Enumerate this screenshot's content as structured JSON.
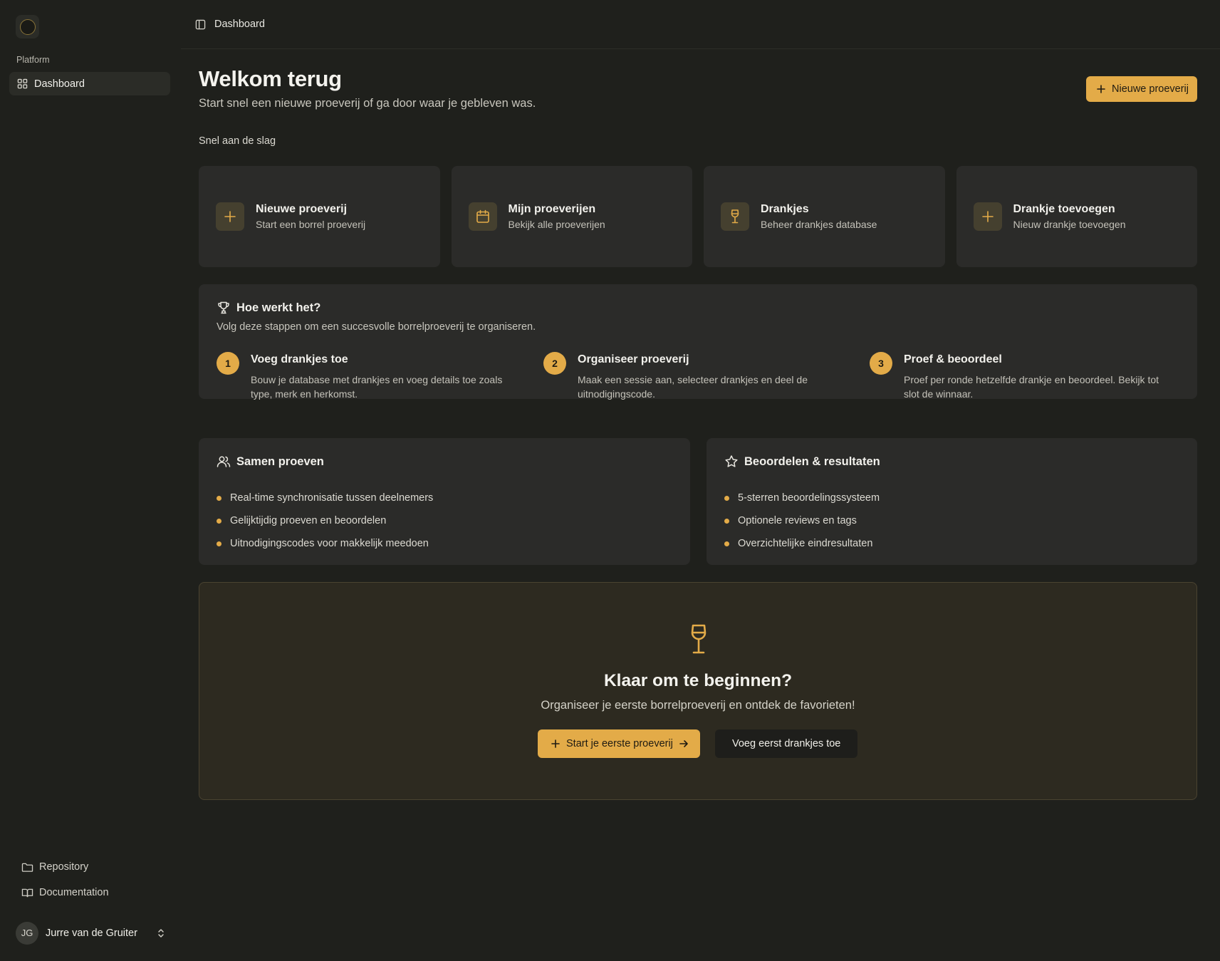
{
  "colors": {
    "accent": "#e3ab48",
    "background": "#1f201c",
    "card": "#2b2b29"
  },
  "topbar": {
    "title": "Dashboard",
    "toggle_icon": "sidebar-toggle-icon"
  },
  "sidebar": {
    "group_label": "Platform",
    "active_item": {
      "label": "Dashboard",
      "icon": "grid-icon"
    },
    "links": [
      {
        "label": "Repository",
        "icon": "folder-icon"
      },
      {
        "label": "Documentation",
        "icon": "book-icon"
      }
    ],
    "user": {
      "initials": "JG",
      "name": "Jurre van de Gruiter"
    }
  },
  "header": {
    "title": "Welkom terug",
    "subtitle": "Start snel een nieuwe proeverij of ga door waar je gebleven was.",
    "new_button": "Nieuwe proeverij"
  },
  "quick_start": {
    "label": "Snel aan de slag",
    "cards": [
      {
        "title": "Nieuwe proeverij",
        "desc": "Start een borrel proeverij",
        "icon": "plus-icon"
      },
      {
        "title": "Mijn proeverijen",
        "desc": "Bekijk alle proeverijen",
        "icon": "calendar-icon"
      },
      {
        "title": "Drankjes",
        "desc": "Beheer drankjes database",
        "icon": "wine-glass-icon"
      },
      {
        "title": "Drankje toevoegen",
        "desc": "Nieuw drankje toevoegen",
        "icon": "plus-icon"
      }
    ]
  },
  "how": {
    "title": "Hoe werkt het?",
    "desc": "Volg deze stappen om een succesvolle borrelproeverij te organiseren.",
    "steps": [
      {
        "num": "1",
        "title": "Voeg drankjes toe",
        "desc": "Bouw je database met drankjes en voeg details toe zoals type, merk en herkomst."
      },
      {
        "num": "2",
        "title": "Organiseer proeverij",
        "desc": "Maak een sessie aan, selecteer drankjes en deel de uitnodigingscode."
      },
      {
        "num": "3",
        "title": "Proef & beoordeel",
        "desc": "Proef per ronde hetzelfde drankje en beoordeel. Bekijk tot slot de winnaar."
      }
    ]
  },
  "features": {
    "together": {
      "title": "Samen proeven",
      "items": [
        "Real-time synchronisatie tussen deelnemers",
        "Gelijktijdig proeven en beoordelen",
        "Uitnodigingscodes voor makkelijk meedoen"
      ]
    },
    "rating": {
      "title": "Beoordelen & resultaten",
      "items": [
        "5-sterren beoordelingssysteem",
        "Optionele reviews en tags",
        "Overzichtelijke eindresultaten"
      ]
    }
  },
  "cta": {
    "title": "Klaar om te beginnen?",
    "desc": "Organiseer je eerste borrelproeverij en ontdek de favorieten!",
    "primary": "Start je eerste proeverij",
    "secondary": "Voeg eerst drankjes toe"
  }
}
